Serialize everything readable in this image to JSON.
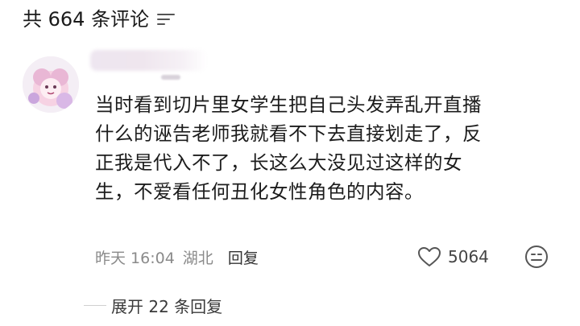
{
  "header": {
    "prefix": "共",
    "count": "664",
    "suffix": "条评论"
  },
  "comment": {
    "lines": [
      "当时看到切片里女学生把自己头发弄乱开直播",
      "什么的诬告老师我就看不下去直接划走了，反",
      "正我是代入不了，长这么大没见过这样的女",
      "生，不爱看任何丑化女性角色的内容。"
    ],
    "time": "昨天 16:04",
    "location": "湖北",
    "reply_label": "回复",
    "likes": "5064"
  },
  "replies": {
    "expand_label": "展开 22 条回复"
  },
  "icons": {
    "sort": "sort-lines-icon",
    "heart": "heart-icon",
    "emoji": "smiley-icon"
  }
}
